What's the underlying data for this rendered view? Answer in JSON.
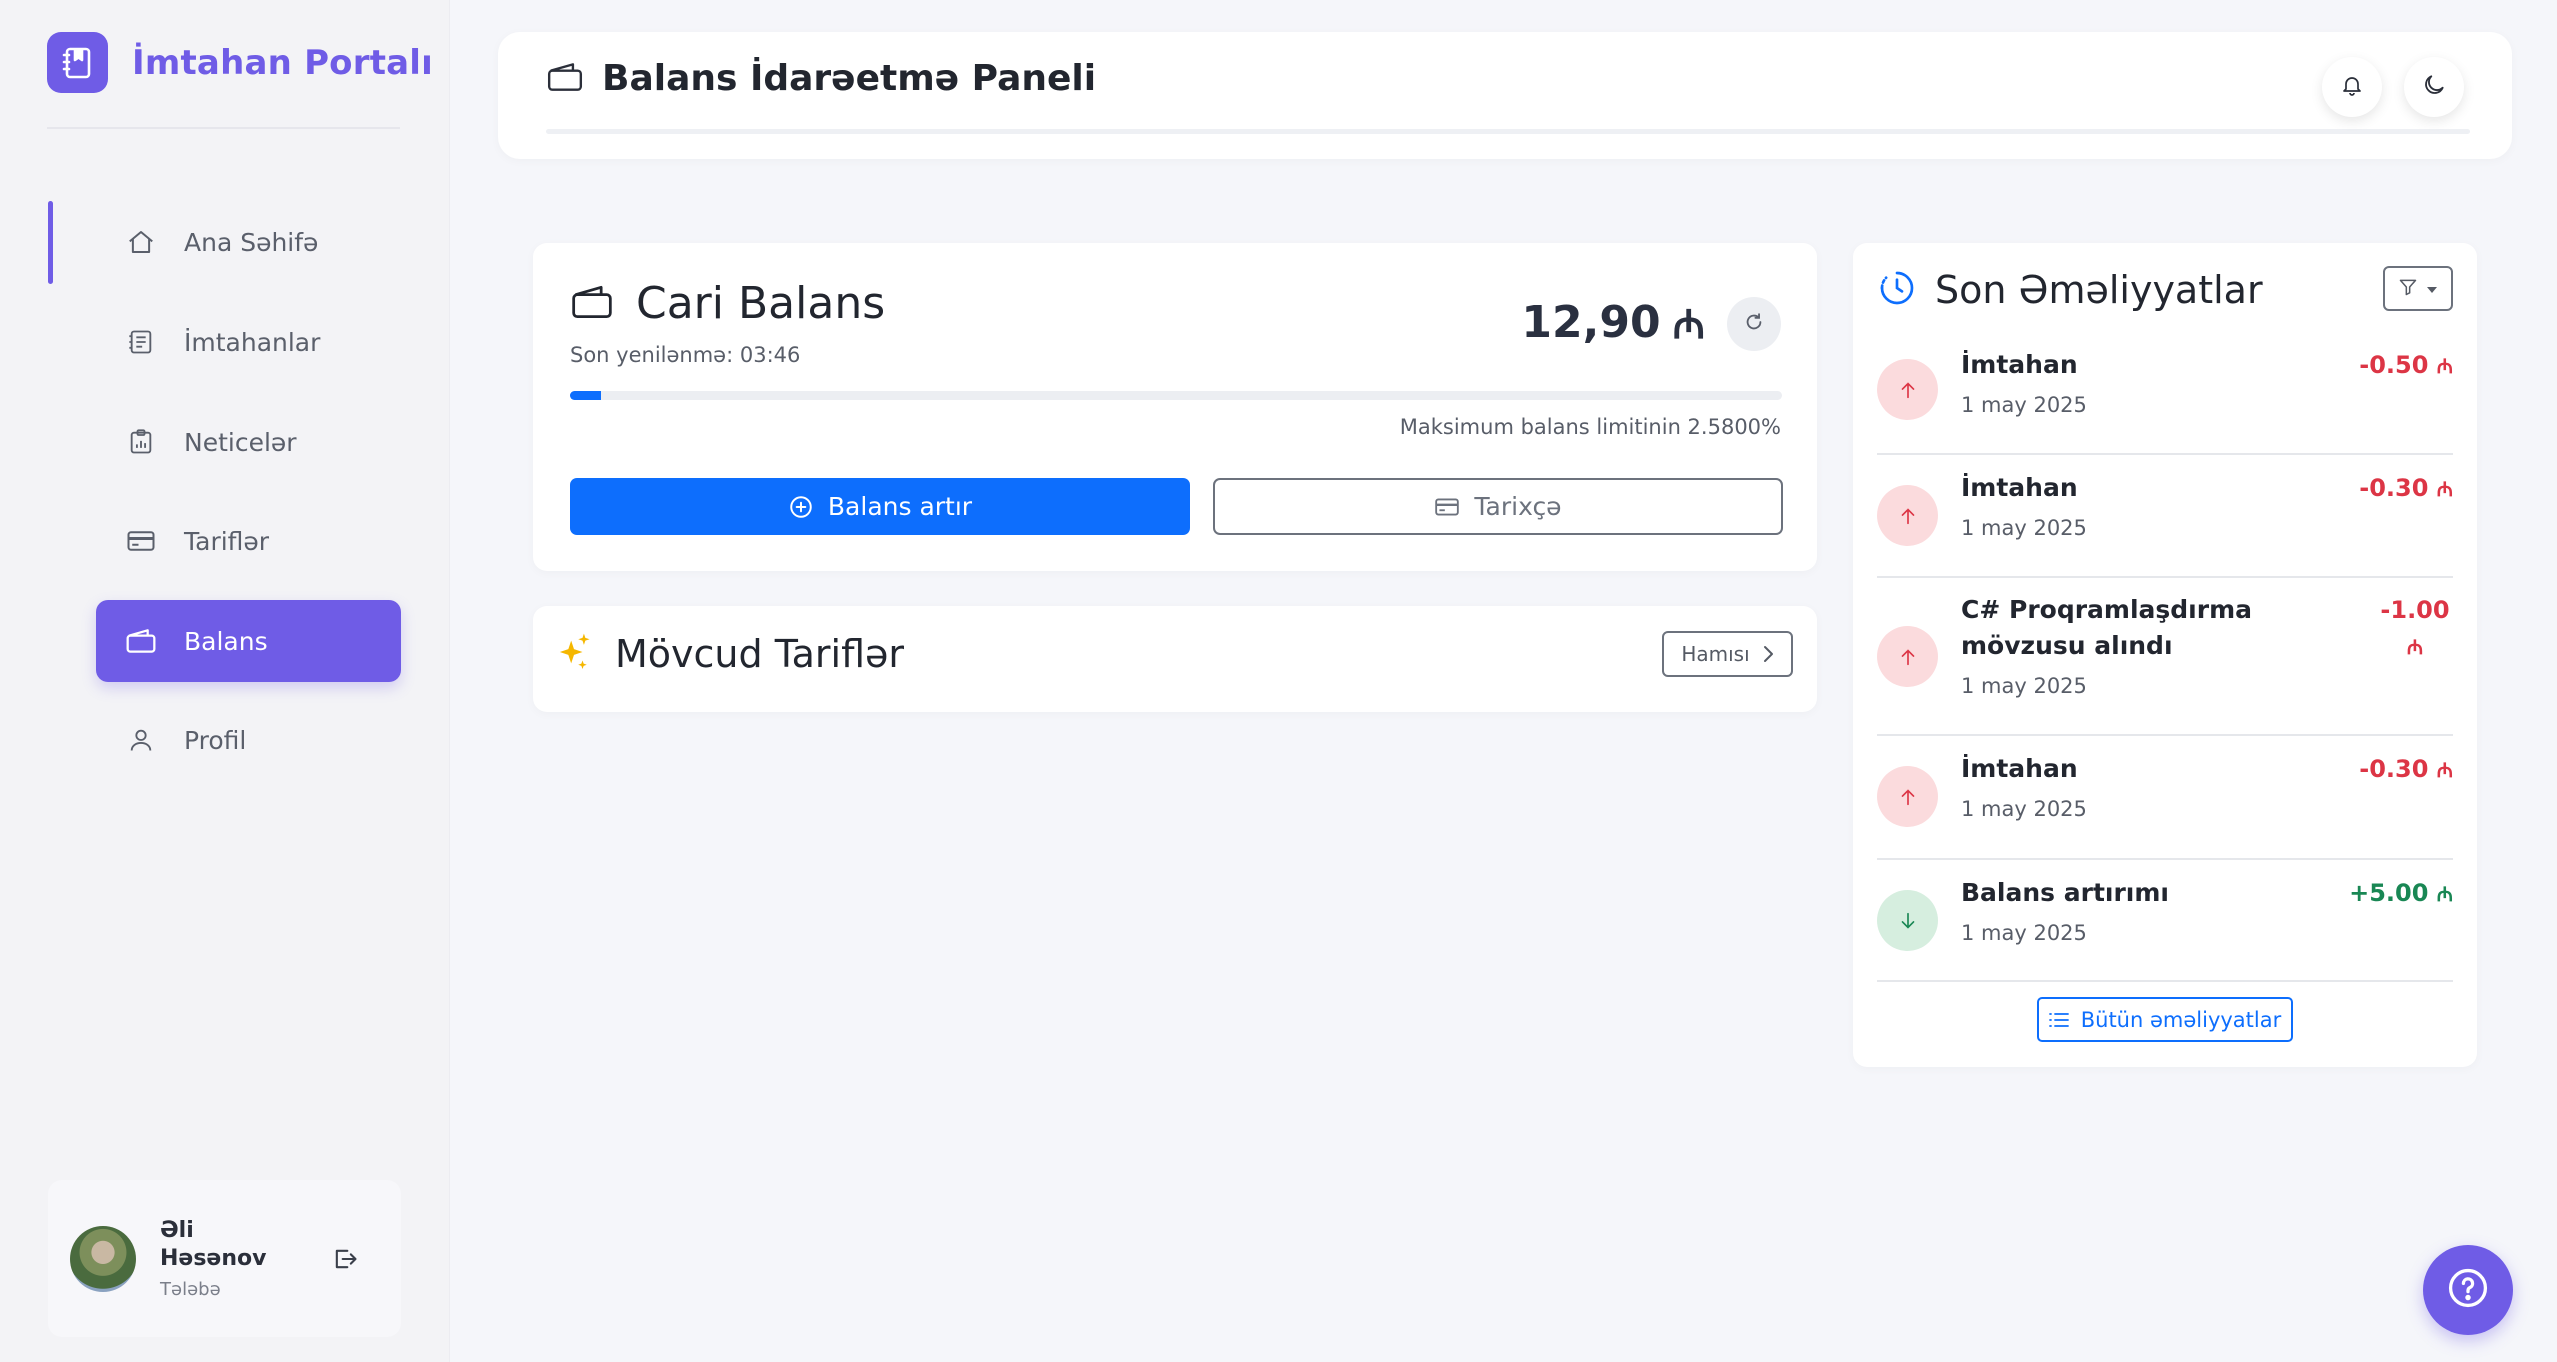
{
  "brand": {
    "title": "İmtahan Portalı"
  },
  "sidebar": {
    "items": [
      {
        "label": "Ana Səhifə",
        "icon": "home-icon"
      },
      {
        "label": "İmtahanlar",
        "icon": "document-icon"
      },
      {
        "label": "Neticelər",
        "icon": "clipboard-chart-icon"
      },
      {
        "label": "Tariflər",
        "icon": "credit-card-icon"
      },
      {
        "label": "Balans",
        "icon": "wallet-icon",
        "active": true
      },
      {
        "label": "Profil",
        "icon": "user-icon"
      }
    ]
  },
  "user": {
    "name": "Əli Həsənov",
    "role": "Tələbə"
  },
  "header": {
    "title": "Balans İdarəetmə Paneli"
  },
  "balance": {
    "title": "Cari Balans",
    "last_updated": "Son yenilənmə: 03:46",
    "amount": "12,90",
    "currency": "₼",
    "progress_fraction": 0.0258,
    "limit_text": "Maksimum balans limitinin 2.5800%",
    "add_button": "Balans artır",
    "history_button": "Tarixçə"
  },
  "tariffs": {
    "title": "Mövcud Tariflər",
    "all_button": "Hamısı"
  },
  "transactions": {
    "title": "Son Əməliyyatlar",
    "items": [
      {
        "title": "İmtahan",
        "date": "1 may 2025",
        "amount": "-0.50",
        "type": "out"
      },
      {
        "title": "İmtahan",
        "date": "1 may 2025",
        "amount": "-0.30",
        "type": "out"
      },
      {
        "title": "C# Proqramlaşdırma mövzusu alındı",
        "date": "1 may 2025",
        "amount": "-1.00",
        "type": "out"
      },
      {
        "title": "İmtahan",
        "date": "1 may 2025",
        "amount": "-0.30",
        "type": "out"
      },
      {
        "title": "Balans artırımı",
        "date": "1 may 2025",
        "amount": "+5.00",
        "type": "in"
      }
    ],
    "all_button": "Bütün əməliyyatlar"
  },
  "colors": {
    "accent": "#6f5ce6",
    "primary": "#0d6efd",
    "danger": "#dc3545",
    "success": "#198754"
  }
}
